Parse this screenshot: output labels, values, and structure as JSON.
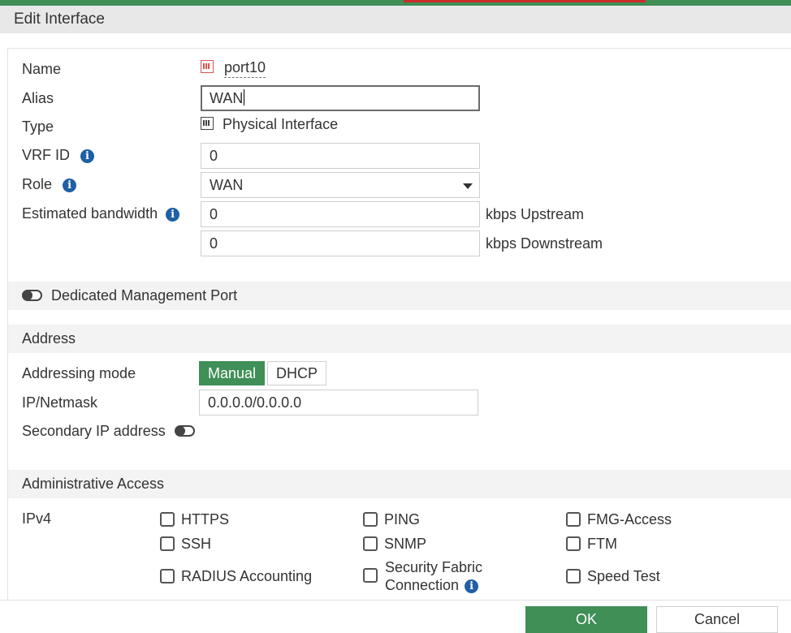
{
  "colors": {
    "accent": "#3f8f56",
    "info": "#1f5fa5",
    "port": "#d9534f"
  },
  "dialog": {
    "title": "Edit Interface"
  },
  "form": {
    "name": {
      "label": "Name",
      "value": "port10",
      "icon": "port-icon"
    },
    "alias": {
      "label": "Alias",
      "value": "WAN"
    },
    "type": {
      "label": "Type",
      "value": "Physical Interface",
      "icon": "port-icon"
    },
    "vrf_id": {
      "label": "VRF ID",
      "value": "0"
    },
    "role": {
      "label": "Role",
      "value": "WAN"
    },
    "bandwidth": {
      "label": "Estimated bandwidth",
      "upstream_value": "0",
      "upstream_unit": "kbps Upstream",
      "downstream_value": "0",
      "downstream_unit": "kbps Downstream"
    },
    "dedicated_mgmt": {
      "label": "Dedicated Management Port",
      "enabled": false
    }
  },
  "address": {
    "section_title": "Address",
    "mode_label": "Addressing mode",
    "modes": [
      "Manual",
      "DHCP"
    ],
    "selected_mode": "Manual",
    "ip_label": "IP/Netmask",
    "ip_value": "0.0.0.0/0.0.0.0",
    "secondary_label": "Secondary IP address",
    "secondary_enabled": false
  },
  "admin_access": {
    "section_title": "Administrative Access",
    "ipv4_label": "IPv4",
    "options": [
      {
        "label": "HTTPS",
        "checked": false
      },
      {
        "label": "PING",
        "checked": false
      },
      {
        "label": "FMG-Access",
        "checked": false
      },
      {
        "label": "SSH",
        "checked": false
      },
      {
        "label": "SNMP",
        "checked": false
      },
      {
        "label": "FTM",
        "checked": false
      },
      {
        "label": "RADIUS Accounting",
        "checked": false
      },
      {
        "label_line1": "Security Fabric",
        "label_line2": "Connection",
        "checked": false,
        "has_info": true
      },
      {
        "label": "Speed Test",
        "checked": false
      }
    ]
  },
  "footer": {
    "ok_label": "OK",
    "cancel_label": "Cancel"
  }
}
